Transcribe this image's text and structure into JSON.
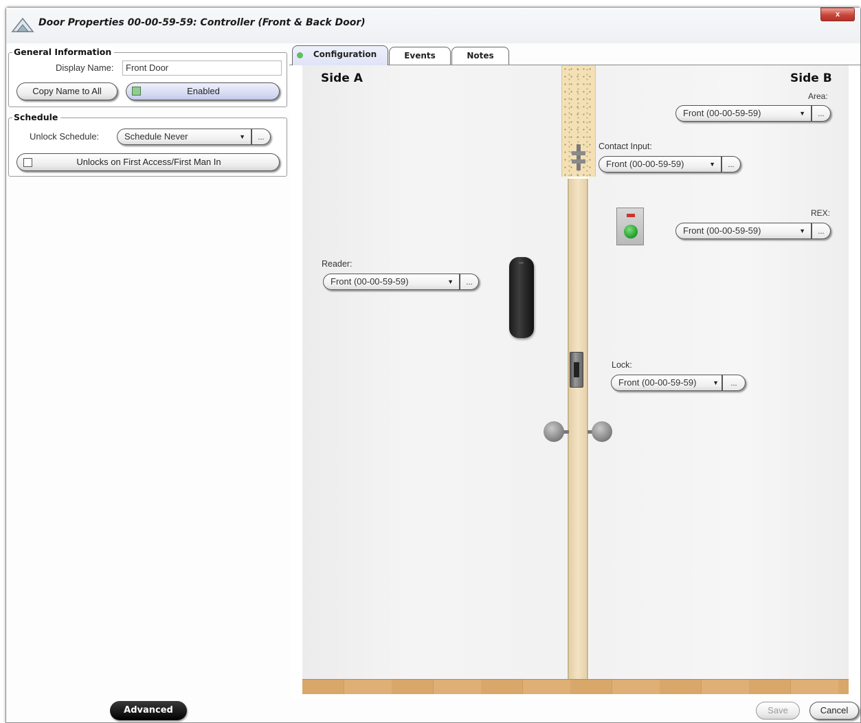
{
  "window": {
    "title": "Door Properties  00-00-59-59: Controller (Front & Back Door)",
    "close_label": "x"
  },
  "general": {
    "label": "General Information",
    "display_name_label": "Display Name:",
    "display_name_value": "Front Door",
    "copy_name_label": "Copy Name to All",
    "enabled_label": "Enabled",
    "enabled_checked": true
  },
  "schedule": {
    "label": "Schedule",
    "unlock_schedule_label": "Unlock Schedule:",
    "unlock_schedule_value": "Schedule Never",
    "browse_label": "...",
    "first_access_label": "Unlocks on First Access/First Man In",
    "first_access_checked": false
  },
  "tabs": [
    {
      "label": "Configuration",
      "active": true
    },
    {
      "label": "Events",
      "active": false
    },
    {
      "label": "Notes",
      "active": false
    }
  ],
  "config": {
    "side_a_label": "Side A",
    "side_b_label": "Side B",
    "area": {
      "label": "Area:",
      "value": "Front (00-00-59-59)"
    },
    "contact_input": {
      "label": "Contact Input:",
      "value": "Front (00-00-59-59)"
    },
    "rex": {
      "label": "REX:",
      "value": "Front (00-00-59-59)"
    },
    "reader": {
      "label": "Reader:",
      "value": "Front (00-00-59-59)"
    },
    "lock": {
      "label": "Lock:",
      "value": "Front (00-00-59-59)"
    },
    "browse_label": "..."
  },
  "footer": {
    "advanced_label": "Advanced",
    "save_label": "Save",
    "cancel_label": "Cancel"
  },
  "colors": {
    "accent_tab": "#dfe3f6",
    "door_wood": "#f3e3c3",
    "floor_wood": "#d9a76a",
    "rex_green": "#1e9a2a"
  }
}
